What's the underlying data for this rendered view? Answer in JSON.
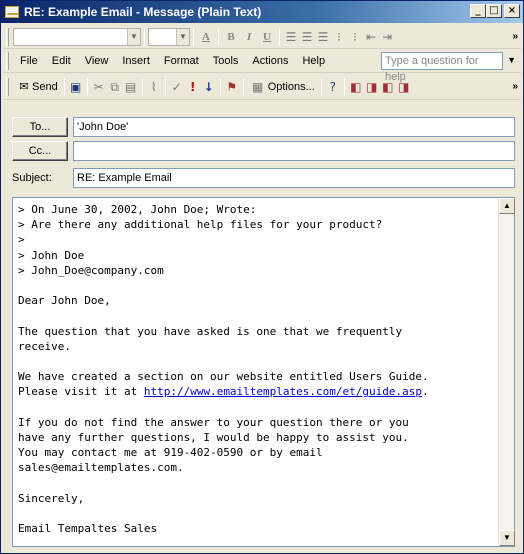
{
  "window": {
    "title": "RE: Example Email - Message (Plain Text)",
    "min": "_",
    "max": "□",
    "close": "×"
  },
  "formatting": {
    "bold": "B",
    "italic": "I",
    "underline": "U",
    "font_color": "A",
    "more": "»"
  },
  "menu": {
    "items": [
      "File",
      "Edit",
      "View",
      "Insert",
      "Format",
      "Tools",
      "Actions",
      "Help"
    ],
    "help_placeholder": "Type a question for help"
  },
  "standard_toolbar": {
    "send_label": "Send",
    "options_label": "Options...",
    "more": "»"
  },
  "fields": {
    "to_button": "To...",
    "to_value": "'John Doe'",
    "cc_button": "Cc...",
    "cc_value": "",
    "subject_label": "Subject:",
    "subject_value": "RE: Example Email"
  },
  "body": {
    "lines": [
      "> On June 30, 2002, John Doe; Wrote:",
      "> Are there any additional help files for your product?",
      ">",
      "> John Doe",
      "> John_Doe@company.com",
      "",
      "Dear John Doe,",
      "",
      "The question that you have asked is one that we frequently",
      "receive.",
      "",
      "We have created a section on our website entitled Users Guide.",
      "Please visit it at ",
      "",
      "If you do not find the answer to your question there or you",
      "have any further questions, I would be happy to assist you.",
      "You may contact me at 919-402-0590 or by email",
      "sales@emailtemplates.com.",
      "",
      "Sincerely,",
      "",
      "Email Tempaltes Sales"
    ],
    "link": "http://www.emailtemplates.com/et/guide.asp",
    "link_suffix": "."
  }
}
